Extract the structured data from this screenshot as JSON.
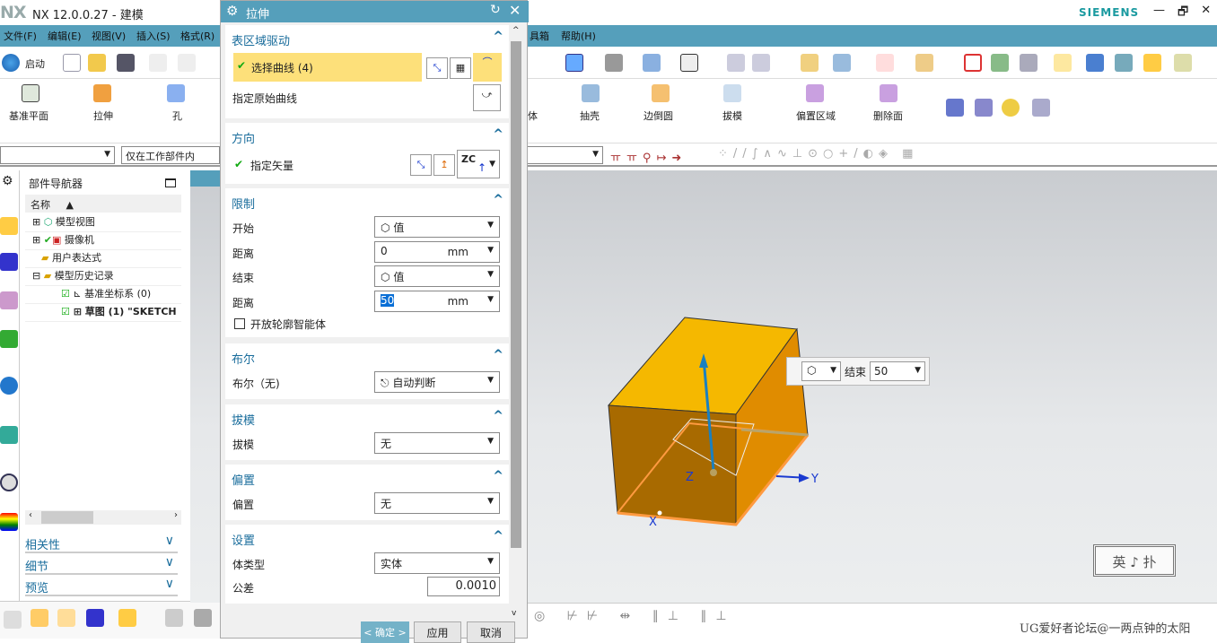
{
  "window": {
    "logo": "NX",
    "title": "NX 12.0.0.27 - 建模",
    "brand": "SIEMENS",
    "controls": [
      "—",
      "🗗",
      "✕"
    ]
  },
  "menu": [
    "文件(F)",
    "编辑(E)",
    "视图(V)",
    "插入(S)",
    "格式(R)",
    "具箱",
    "帮助(H)"
  ],
  "toolbar": {
    "start_label": "启动"
  },
  "ribbon": {
    "items": [
      "基准平面",
      "拉伸",
      "孔",
      "体",
      "抽壳",
      "边倒圆",
      "拔模",
      "偏置区域",
      "删除面"
    ]
  },
  "selection": {
    "filter_value": "",
    "scope_value": "仅在工作部件内"
  },
  "navigator": {
    "title": "部件导航器",
    "column": "名称",
    "rows": [
      "模型视图",
      "摄像机",
      "用户表达式",
      "模型历史记录",
      "基准坐标系 (0)",
      "草图 (1) \"SKETCH"
    ],
    "sections": [
      "相关性",
      "细节",
      "预览"
    ]
  },
  "dialog": {
    "title": "拉伸",
    "sections": {
      "section_curve": {
        "title": "表区域驱动",
        "select_curve": "选择曲线 (4)",
        "origin_curve": "指定原始曲线"
      },
      "direction": {
        "title": "方向",
        "vector": "指定矢量",
        "vector_option": "ZC"
      },
      "limits": {
        "title": "限制",
        "start_label": "开始",
        "start_value": "值",
        "dist1_label": "距离",
        "dist1_value": "0",
        "unit": "mm",
        "end_label": "结束",
        "end_value": "值",
        "dist2_label": "距离",
        "dist2_value": "50",
        "open_profile": "开放轮廓智能体",
        "open_profile_checked": false
      },
      "boolean": {
        "title": "布尔",
        "label": "布尔（无)",
        "value": "自动判断"
      },
      "draft": {
        "title": "拔模",
        "label": "拔模",
        "value": "无"
      },
      "offset": {
        "title": "偏置",
        "label": "偏置",
        "value": "无"
      },
      "settings": {
        "title": "设置",
        "body_type_label": "体类型",
        "body_type_value": "实体",
        "tolerance_label": "公差",
        "tolerance_value": "0.0010"
      }
    },
    "ok": "< 确定 >",
    "apply": "应用",
    "cancel": "取消"
  },
  "viewport": {
    "float_end_label": "结束",
    "float_end_value": "50",
    "axes": [
      "X",
      "Y",
      "Z"
    ],
    "stamp": "英 ♪ 扑",
    "watermark": "UG爱好者论坛@一两点钟的太阳"
  },
  "colors": {
    "accent": "#559fbb",
    "box_top": "#f5b800",
    "box_front": "#a86a00",
    "box_side": "#e08c00",
    "edge_highlight": "#ff9a40",
    "selected_row": "#fde07a"
  }
}
